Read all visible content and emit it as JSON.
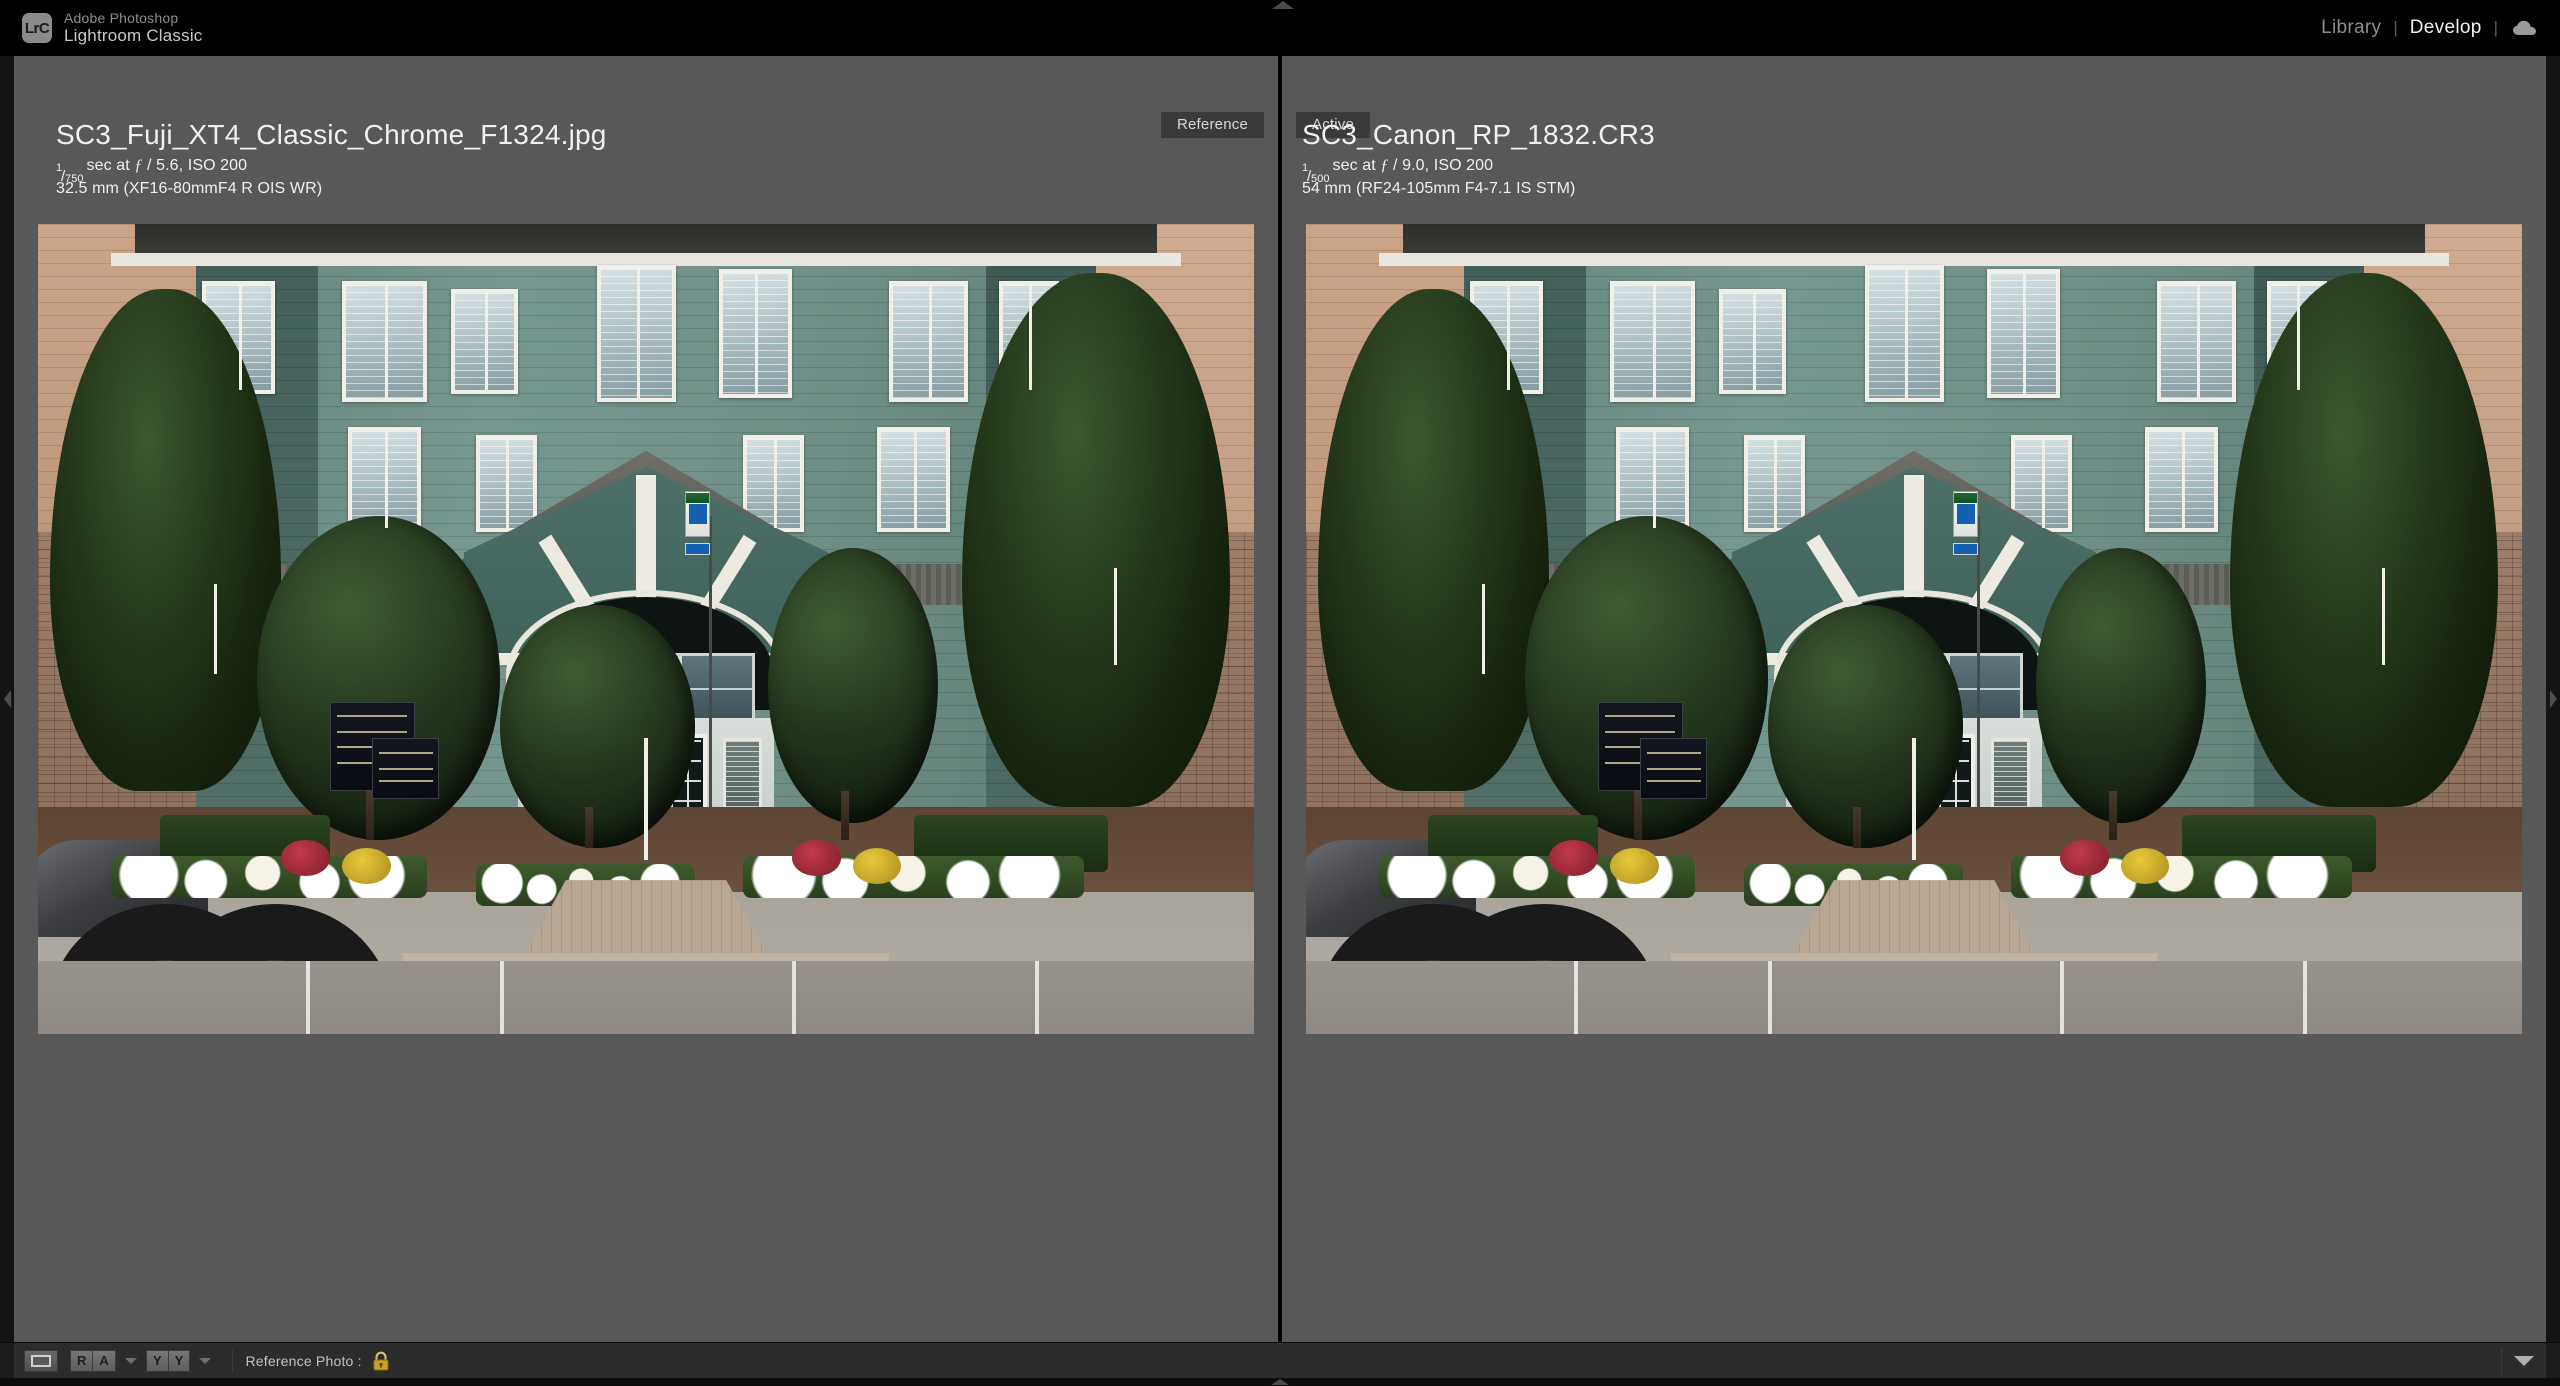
{
  "app": {
    "logo_text": "LrC",
    "suite_name": "Adobe Photoshop",
    "product_name": "Lightroom Classic"
  },
  "modules": {
    "items": [
      {
        "label": "Library",
        "active": false
      },
      {
        "label": "Develop",
        "active": true
      }
    ],
    "separator": "|",
    "cloud_icon": "cloud-sync-icon"
  },
  "compare": {
    "reference_tab_label": "Reference",
    "active_tab_label": "Active",
    "reference": {
      "filename": "SC3_Fuji_XT4_Classic_Chrome_F1324.jpg",
      "shutter_numerator": "1",
      "shutter_denominator": "750",
      "exposure_line": "sec at",
      "aperture_symbol": "ƒ",
      "aperture": "/ 5.6, ISO 200",
      "lens_line": "32.5 mm (XF16-80mmF4 R OIS WR)",
      "subject": "apartment-building-leasing-center-exterior"
    },
    "active": {
      "filename": "SC3_Canon_RP_1832.CR3",
      "shutter_numerator": "1",
      "shutter_denominator": "500",
      "exposure_line": "sec at",
      "aperture_symbol": "ƒ",
      "aperture": "/ 9.0, ISO 200",
      "lens_line": "54 mm (RF24-105mm F4-7.1 IS STM)",
      "subject": "apartment-building-leasing-center-exterior"
    }
  },
  "toolbar": {
    "loupe_view_icon": "loupe-view-icon",
    "reference_active_button": {
      "left": "R",
      "right": "A"
    },
    "before_after_button": {
      "left": "Y",
      "right": "Y"
    },
    "caret_icon": "chevron-down-icon",
    "reference_photo_label": "Reference Photo :",
    "lock_icon": "lock-closed-icon",
    "panel_toggle_icon": "triangle-down-icon"
  },
  "panels": {
    "left_handle_icon": "triangle-left-icon",
    "right_handle_icon": "triangle-right-icon",
    "top_collapse_icon": "triangle-up-icon",
    "filmstrip_handle_icon": "triangle-down-dots-icon"
  },
  "colors": {
    "window_bg": "#000000",
    "pane_bg": "#585858",
    "toolbar_bg": "#2c2c2c",
    "active_module": "#f2f2f2",
    "inactive_module": "#8e8e8e",
    "lock_gold": "#c9a227",
    "tab_bg": "#3a3a3a"
  }
}
